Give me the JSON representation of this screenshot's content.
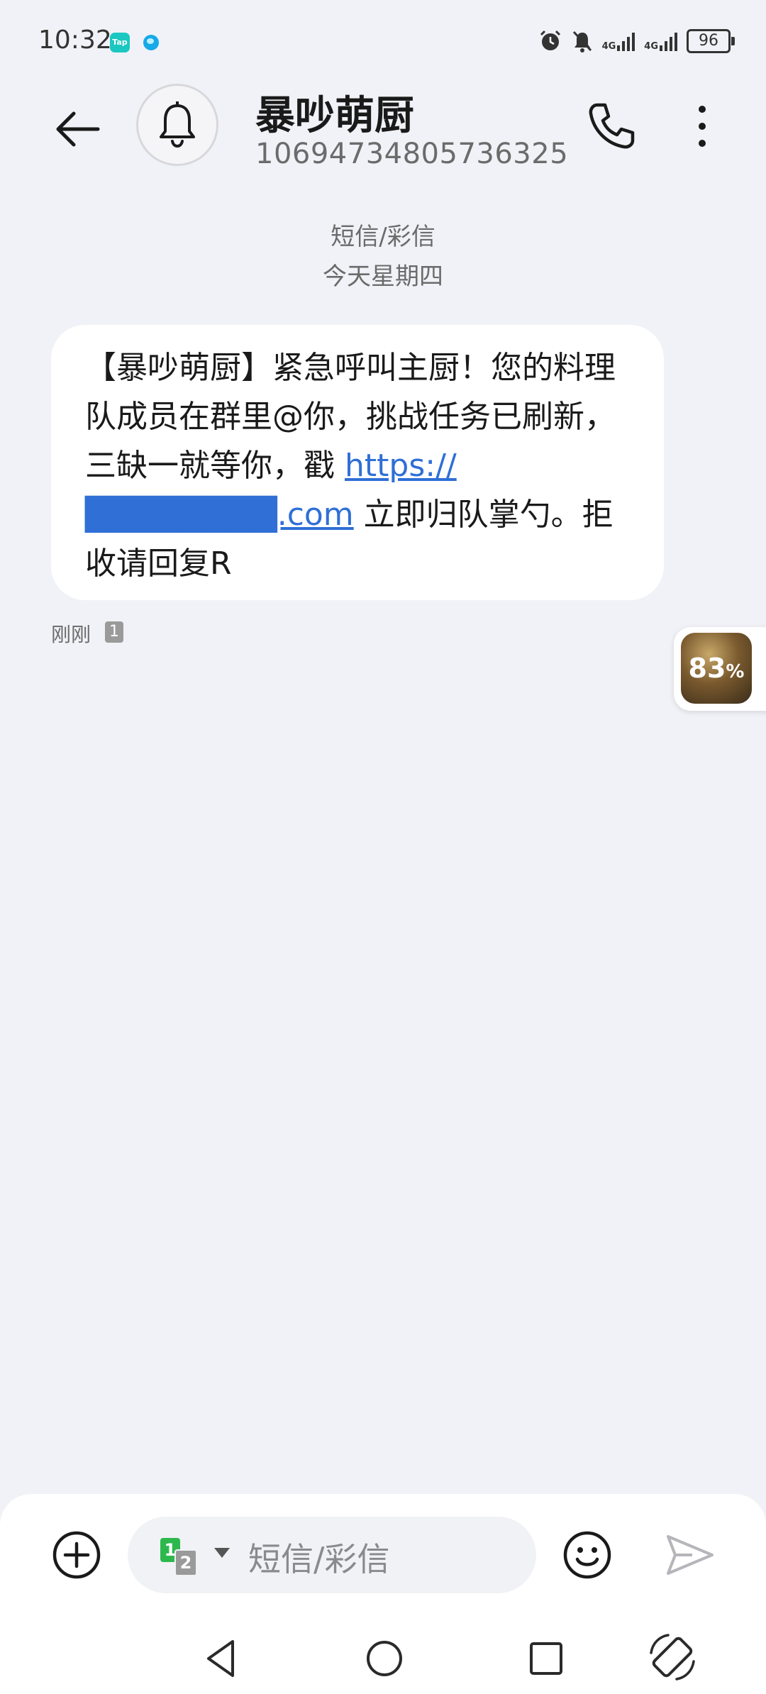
{
  "status_bar": {
    "time": "10:32",
    "notification_badge": "Tap",
    "signal_1_label": "4G",
    "signal_2_label": "4G",
    "battery": "96"
  },
  "header": {
    "contact_name": "暴吵萌厨",
    "contact_number": "10694734805736325",
    "avatar_icon": "bell-icon"
  },
  "conversation": {
    "message_type": "短信/彩信",
    "date_label": "今天星期四",
    "message": {
      "text_before_link": "【暴吵萌厨】紧急呼叫主厨！您的料理队成员在群里@你，挑战任务已刷新，三缺一就等你，戳 ",
      "link_text": "https://████████.com",
      "text_after_link": " 立即归队掌勺。拒收请回复R",
      "time": "刚刚",
      "sim": "1"
    }
  },
  "floating_widget": {
    "value": "83",
    "unit": "%"
  },
  "compose": {
    "placeholder": "短信/彩信",
    "sim_primary": "1",
    "sim_secondary": "2"
  },
  "colors": {
    "background": "#f1f2f7",
    "link": "#2f6fd6",
    "sim1": "#2db84d"
  }
}
